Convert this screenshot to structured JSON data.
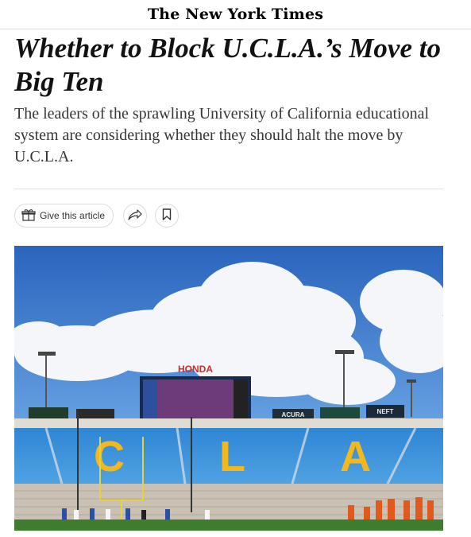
{
  "masthead": {
    "logo_text": "The New York Times"
  },
  "article": {
    "headline": "Whether to Block U.C.L.A.’s Move to Big Ten",
    "summary": "The leaders of the sprawling University of California educational system are considering whether they should halt the move by U.C.L.A."
  },
  "share_bar": {
    "gift_label": "Give this article",
    "gift_icon": "gift-icon",
    "share_icon": "share-arrow-icon",
    "save_icon": "bookmark-icon"
  },
  "photo": {
    "scoreboard_brand": "HONDA",
    "end_zone_letters": [
      "C",
      "L",
      "A"
    ],
    "signage": [
      "ACURA",
      "NEFT"
    ],
    "colors": {
      "sky": "#2f6fc6",
      "seats": "#3a8fd8",
      "letters": "#f2b81e",
      "field": "#3f7d2e"
    }
  }
}
